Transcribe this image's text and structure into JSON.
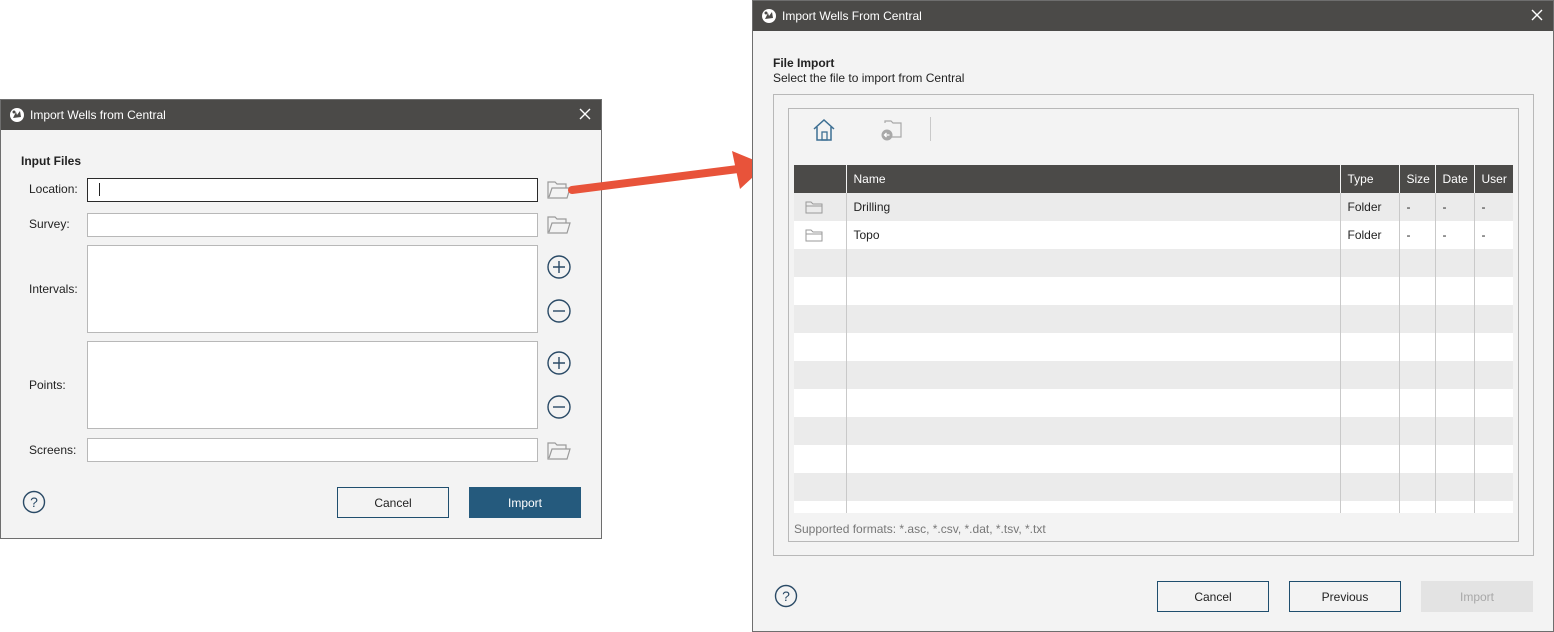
{
  "left_dialog": {
    "title": "Import Wells from Central",
    "section_title": "Input Files",
    "fields": {
      "location_label": "Location:",
      "location_value": "",
      "survey_label": "Survey:",
      "survey_value": "",
      "intervals_label": "Intervals:",
      "points_label": "Points:",
      "screens_label": "Screens:",
      "screens_value": ""
    },
    "buttons": {
      "cancel": "Cancel",
      "import": "Import"
    }
  },
  "right_dialog": {
    "title": "Import Wells From Central",
    "section_title": "File Import",
    "section_subtitle": "Select the file to import from Central",
    "table": {
      "columns": [
        "Name",
        "Type",
        "Size",
        "Date",
        "User"
      ],
      "rows": [
        {
          "icon": "folder-icon",
          "name": "Drilling",
          "type": "Folder",
          "size": "-",
          "date": "-",
          "user": "-"
        },
        {
          "icon": "folder-icon",
          "name": "Topo",
          "type": "Folder",
          "size": "-",
          "date": "-",
          "user": "-"
        }
      ]
    },
    "supported_formats": "Supported formats: *.asc, *.csv, *.dat, *.tsv, *.txt",
    "buttons": {
      "cancel": "Cancel",
      "previous": "Previous",
      "import": "Import"
    }
  },
  "colors": {
    "title_bar": "#4b4a48",
    "accent": "#255a7d",
    "arrow": "#e8533a",
    "dialog_bg": "#f3f3f3"
  }
}
